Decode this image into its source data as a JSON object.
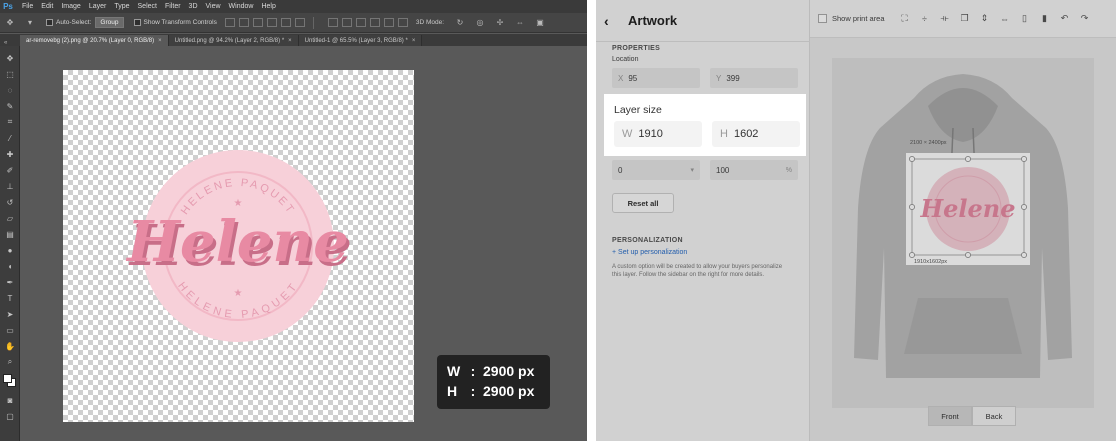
{
  "photoshop": {
    "logo": "Ps",
    "menu": [
      "File",
      "Edit",
      "Image",
      "Layer",
      "Type",
      "Select",
      "Filter",
      "3D",
      "View",
      "Window",
      "Help"
    ],
    "options": {
      "auto_select_label": "Auto-Select:",
      "auto_select_value": "Group",
      "transform_controls_label": "Show Transform Controls",
      "mode_3d_label": "3D Mode:"
    },
    "tabs": [
      {
        "label": "ar-removebg (2).png @ 20.7% (Layer 0, RGB/8)",
        "close": "×"
      },
      {
        "label": "Untitled.png @ 94.2% (Layer 2, RGB/8) *",
        "close": "×"
      },
      {
        "label": "Untitled-1 @ 65.5% (Layer 3, RGB/8) *",
        "close": "×"
      }
    ],
    "hud": {
      "w_label": "W",
      "w_value": "2900 px",
      "h_label": "H",
      "h_value": "2900 px",
      "colon": ":"
    }
  },
  "logo_art": {
    "top_text": "HELENE PAQUET",
    "bottom_text": "HELENE PAQUET",
    "script_text": "Helene",
    "colors": {
      "circle": "#f7d0d9",
      "ring": "#f2b8c6",
      "text": "#e88aa3",
      "shadow": "#c86e88"
    }
  },
  "artwork": {
    "title": "Artwork",
    "back_icon": "chevron-left-icon",
    "properties_label": "PROPERTIES",
    "location_label": "Location",
    "x_label": "X",
    "x_value": "95",
    "y_label": "Y",
    "y_value": "399",
    "layer_size_label": "Layer size",
    "w_label": "W",
    "w_value": "1910",
    "h_label": "H",
    "h_value": "1602",
    "rotation_value": "0",
    "scale_value": "100",
    "scale_unit": "%",
    "reset_label": "Reset all",
    "personalization_label": "PERSONALIZATION",
    "setup_link": "+ Set up personalization",
    "help_text": "A custom option will be created to allow your buyers personalize this layer. Follow the sidebar on the right for more details.",
    "print_area_label": "Show print area",
    "print_area_size": "2100 × 2400px",
    "layer_dims_label": "1910x1602px",
    "view_tabs": [
      "Front",
      "Back"
    ],
    "active_view": "Front"
  }
}
